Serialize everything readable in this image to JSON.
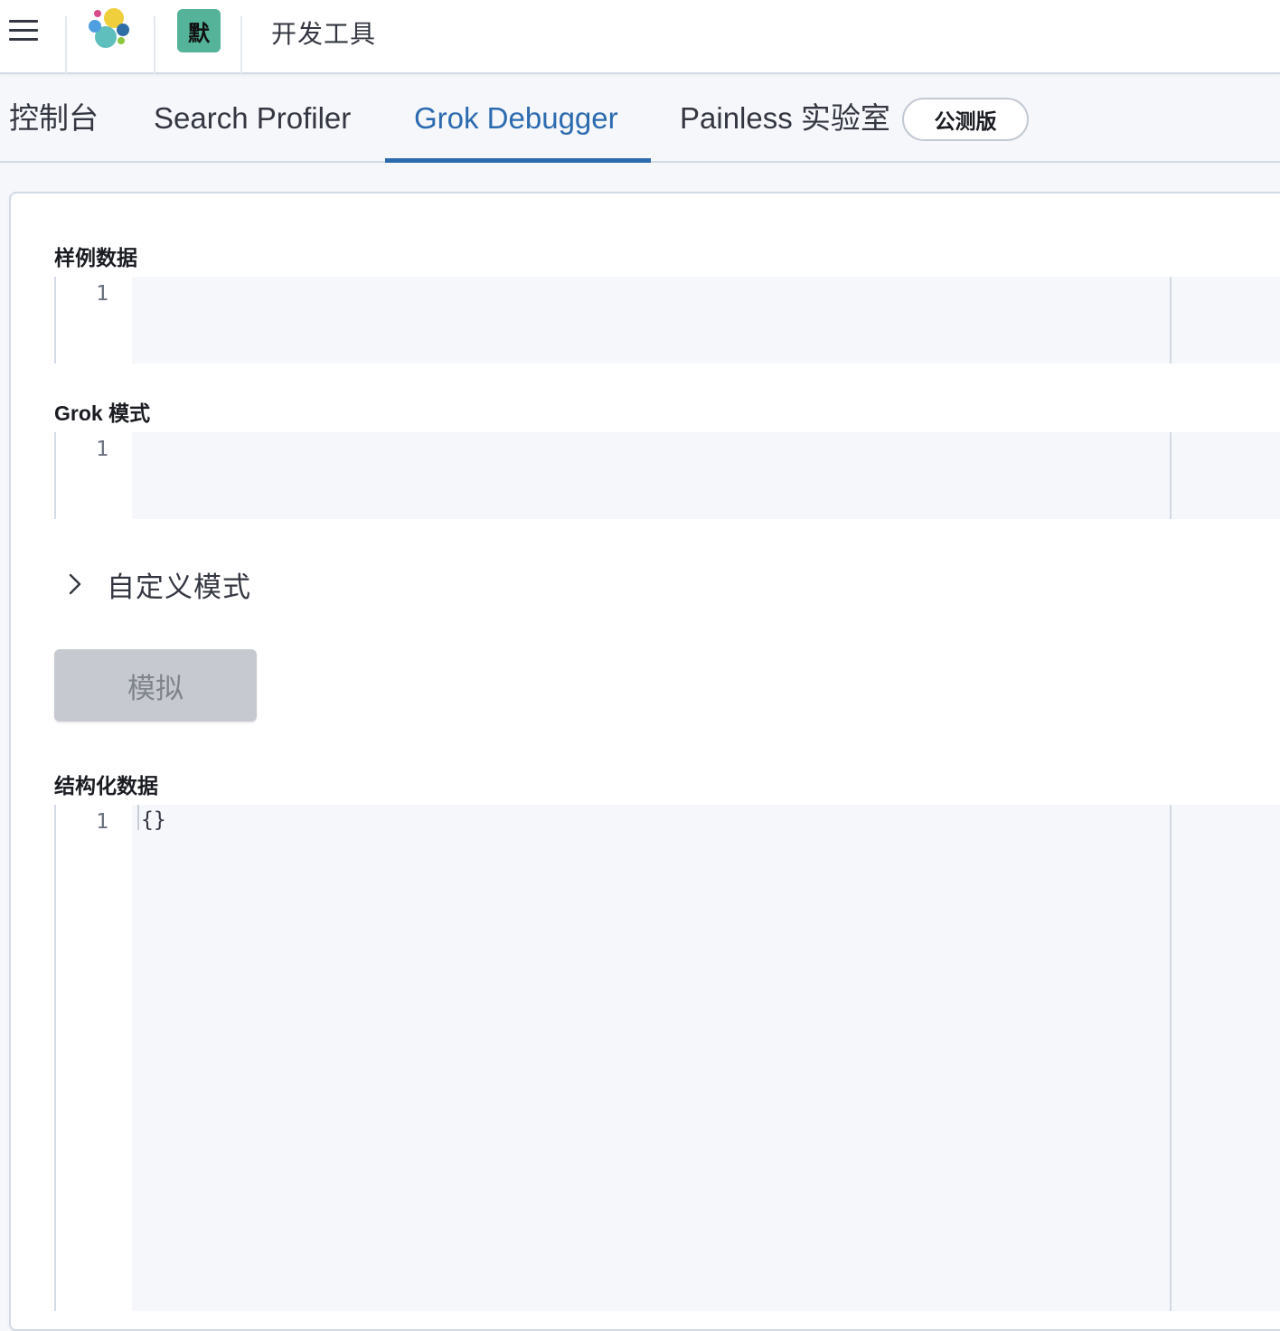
{
  "header": {
    "menu_icon": "hamburger-menu-icon",
    "logo_icon": "elastic-logo-icon",
    "space_avatar": "默",
    "breadcrumb": "开发工具"
  },
  "tabs": [
    {
      "label": "控制台",
      "active": false
    },
    {
      "label": "Search Profiler",
      "active": false
    },
    {
      "label": "Grok Debugger",
      "active": true
    },
    {
      "label": "Painless 实验室",
      "active": false
    }
  ],
  "beta_badge": "公测版",
  "form": {
    "sample_data": {
      "label": "样例数据",
      "line_number": "1",
      "value": ""
    },
    "grok_pattern": {
      "label": "Grok 模式",
      "line_number": "1",
      "value": ""
    },
    "custom_patterns": {
      "label": "自定义模式",
      "icon": "chevron-right-icon"
    },
    "simulate_button": "模拟",
    "structured_data": {
      "label": "结构化数据",
      "line_number": "1",
      "value": "{}"
    }
  },
  "colors": {
    "accent": "#2c6bb0",
    "space_avatar_bg": "#54b399",
    "editor_bg": "#f5f7fa",
    "disabled_button_bg": "#c6c9cf"
  }
}
